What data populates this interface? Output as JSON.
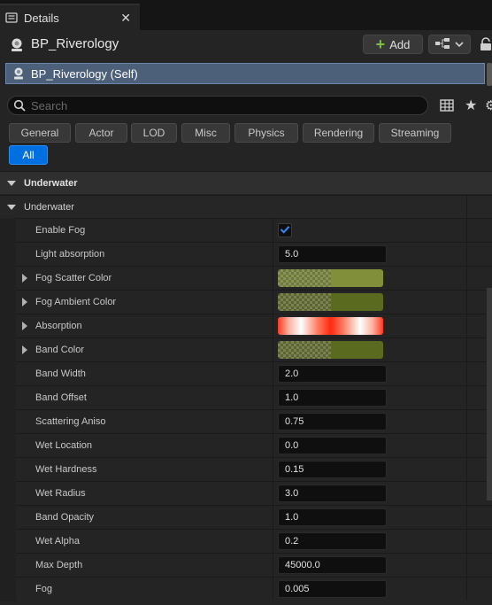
{
  "tab": {
    "title": "Details",
    "close_glyph": "✕"
  },
  "header": {
    "blueprint_name": "BP_Riverology",
    "add_label": "Add"
  },
  "self_row": {
    "label": "BP_Riverology (Self)"
  },
  "search": {
    "placeholder": "Search",
    "value": ""
  },
  "filters": [
    "General",
    "Actor",
    "LOD",
    "Misc",
    "Physics",
    "Rendering",
    "Streaming",
    "All"
  ],
  "active_filter": "All",
  "category": {
    "label": "Underwater"
  },
  "subcategory": {
    "label": "Underwater"
  },
  "properties": [
    {
      "name": "Enable Fog",
      "type": "checkbox",
      "checked": true
    },
    {
      "name": "Light absorption",
      "type": "number",
      "value": "5.0"
    },
    {
      "name": "Fog Scatter Color",
      "type": "color",
      "expandable": true,
      "color": "#828f3a"
    },
    {
      "name": "Fog Ambient Color",
      "type": "color",
      "expandable": true,
      "color": "#5a6a1e"
    },
    {
      "name": "Absorption",
      "type": "gradient",
      "expandable": true,
      "color": "#ff3a1e"
    },
    {
      "name": "Band Color",
      "type": "color",
      "expandable": true,
      "color": "#5a6a1e"
    },
    {
      "name": "Band Width",
      "type": "number",
      "value": "2.0"
    },
    {
      "name": "Band Offset",
      "type": "number",
      "value": "1.0"
    },
    {
      "name": "Scattering Aniso",
      "type": "number",
      "value": "0.75"
    },
    {
      "name": "Wet Location",
      "type": "number",
      "value": "0.0"
    },
    {
      "name": "Wet Hardness",
      "type": "number",
      "value": "0.15"
    },
    {
      "name": "Wet Radius",
      "type": "number",
      "value": "3.0"
    },
    {
      "name": "Band Opacity",
      "type": "number",
      "value": "1.0"
    },
    {
      "name": "Wet Alpha",
      "type": "number",
      "value": "0.2"
    },
    {
      "name": "Max Depth",
      "type": "number",
      "value": "45000.0"
    },
    {
      "name": "Fog",
      "type": "number",
      "value": "0.005"
    }
  ],
  "colors": {
    "panel_bg": "#242424",
    "accent_blue": "#0070e0",
    "selection": "#4c607a",
    "add_plus": "#7ac043"
  },
  "icons": [
    "details-icon",
    "close-icon",
    "blueprint-icon",
    "add-icon",
    "hierarchy-icon",
    "chevron-down-icon",
    "lock-icon",
    "actor-icon",
    "search-icon",
    "grid-icon",
    "star-icon",
    "gear-icon",
    "expand-arrow-icon",
    "checkmark-icon"
  ]
}
